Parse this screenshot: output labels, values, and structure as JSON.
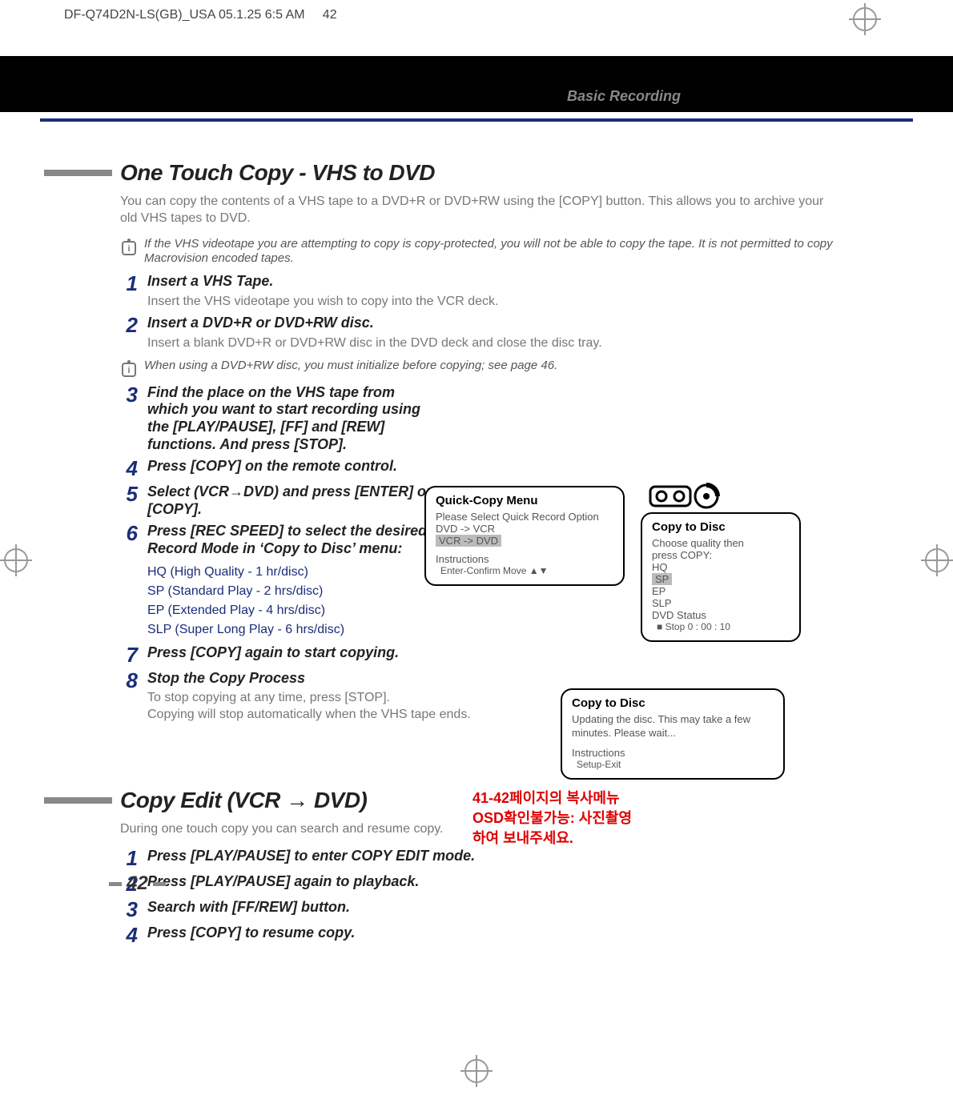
{
  "header_line": "DF-Q74D2N-LS(GB)_USA   05.1.25 6:5 AM       42",
  "banner_label": "Basic Recording",
  "section1": {
    "title": "One Touch Copy - VHS to DVD",
    "intro": "You can copy the contents of a VHS tape to a DVD+R or DVD+RW using the [COPY] button. This allows you to archive your old VHS tapes to DVD.",
    "note1": "If the VHS videotape you are attempting to copy is copy-protected, you will not be able to copy the tape. It is not permitted to copy Macrovision encoded tapes.",
    "steps": [
      {
        "num": "1",
        "title": "Insert a VHS Tape.",
        "desc": "Insert the VHS videotape you wish to copy into the VCR deck."
      },
      {
        "num": "2",
        "title": "Insert a DVD+R or DVD+RW disc.",
        "desc": "Insert a blank DVD+R or DVD+RW disc in the DVD deck and close the disc tray."
      }
    ],
    "note2": "When using a DVD+RW disc, you must initialize before copying; see page 46.",
    "steps_b": [
      {
        "num": "3",
        "title": "Find the place on the VHS tape from which you want to start recording using the [PLAY/PAUSE], [FF] and [REW] functions. And press [STOP]."
      },
      {
        "num": "4",
        "title": "Press [COPY] on the remote control."
      },
      {
        "num": "5",
        "title": "Select (VCR→DVD) and press [ENTER] or [COPY]."
      },
      {
        "num": "6",
        "title": "Press [REC SPEED] to select the desired Record Mode in ‘Copy to Disc’ menu:"
      }
    ],
    "modes": [
      "HQ (High Quality - 1 hr/disc)",
      "SP (Standard Play - 2 hrs/disc)",
      "EP (Extended Play - 4 hrs/disc)",
      "SLP (Super Long Play - 6 hrs/disc)"
    ],
    "steps_c": [
      {
        "num": "7",
        "title": "Press [COPY] again to start copying."
      },
      {
        "num": "8",
        "title": "Stop the Copy Process",
        "desc": "To stop copying at any time, press [STOP].\nCopying will stop automatically when the VHS tape ends."
      }
    ]
  },
  "osd1": {
    "title": "Quick-Copy Menu",
    "line1": "Please Select Quick Record Option",
    "opt1": "DVD -> VCR",
    "opt2_sel": "VCR -> DVD",
    "instr_label": "Instructions",
    "instr_sub": "Enter-Confirm  Move ▲▼"
  },
  "osd2": {
    "title": "Copy to Disc",
    "line1": "Choose quality then",
    "line2": "press COPY:",
    "opts": [
      "HQ",
      "SP",
      "EP",
      "SLP"
    ],
    "sel_index": 1,
    "status_label": "DVD Status",
    "status_val": "■ Stop      0 : 00 : 10"
  },
  "osd3": {
    "title": "Copy to Disc",
    "body": "Updating the disc. This may take a few minutes. Please wait...",
    "instr_label": "Instructions",
    "instr_sub": "Setup-Exit"
  },
  "red_note": "41-42페이지의  복사메뉴\nOSD확인불가능:  사진촬영\n하여  보내주세요.",
  "section2": {
    "title": "Copy Edit (VCR → DVD)",
    "intro": "During one touch copy you can search and resume copy.",
    "steps": [
      {
        "num": "1",
        "title": "Press [PLAY/PAUSE] to enter COPY EDIT mode."
      },
      {
        "num": "2",
        "title": "Press [PLAY/PAUSE] again to playback."
      },
      {
        "num": "3",
        "title": "Search with [FF/REW] button."
      },
      {
        "num": "4",
        "title": "Press [COPY] to resume copy."
      }
    ]
  },
  "page_number": "42"
}
